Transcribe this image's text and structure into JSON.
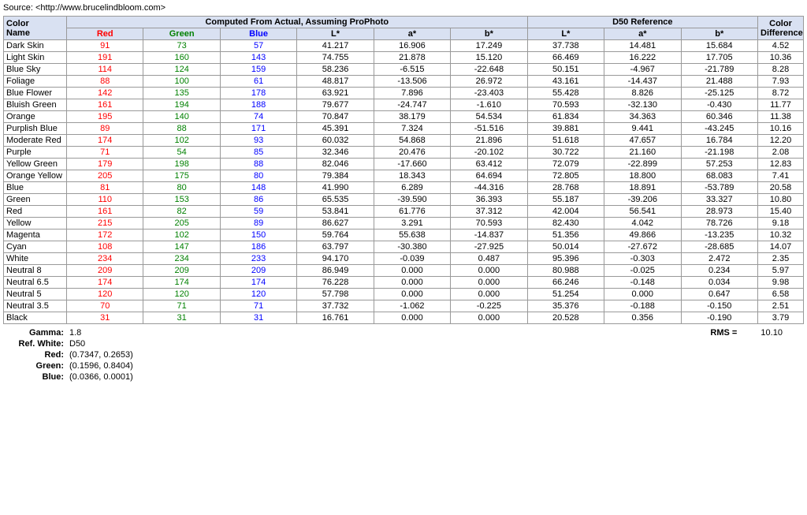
{
  "source": "Source: <http://www.brucelindbloom.com>",
  "headers": {
    "color_name": "Color\nName",
    "computed_group": "Computed From Actual, Assuming ProPhoto",
    "d50_group": "D50 Reference",
    "color_diff": "Color\nDifference",
    "sub_headers": [
      "Red",
      "Green",
      "Blue",
      "L*",
      "a*",
      "b*",
      "L*",
      "a*",
      "b*"
    ]
  },
  "rows": [
    {
      "name": "Dark Skin",
      "r": 91,
      "g": 73,
      "b": 57,
      "L1": 41.217,
      "a1": 16.906,
      "b1": 17.249,
      "L2": 37.738,
      "a2": 14.481,
      "b2": 15.684,
      "diff": 4.52
    },
    {
      "name": "Light Skin",
      "r": 191,
      "g": 160,
      "b": 143,
      "L1": 74.755,
      "a1": 21.878,
      "b1": 15.12,
      "L2": 66.469,
      "a2": 16.222,
      "b2": 17.705,
      "diff": 10.36
    },
    {
      "name": "Blue Sky",
      "r": 114,
      "g": 124,
      "b": 159,
      "L1": 58.236,
      "a1": -6.515,
      "b1": -22.648,
      "L2": 50.151,
      "a2": -4.967,
      "b2": -21.789,
      "diff": 8.28
    },
    {
      "name": "Foliage",
      "r": 88,
      "g": 100,
      "b": 61,
      "L1": 48.817,
      "a1": -13.506,
      "b1": 26.972,
      "L2": 43.161,
      "a2": -14.437,
      "b2": 21.488,
      "diff": 7.93
    },
    {
      "name": "Blue Flower",
      "r": 142,
      "g": 135,
      "b": 178,
      "L1": 63.921,
      "a1": 7.896,
      "b1": -23.403,
      "L2": 55.428,
      "a2": 8.826,
      "b2": -25.125,
      "diff": 8.72
    },
    {
      "name": "Bluish Green",
      "r": 161,
      "g": 194,
      "b": 188,
      "L1": 79.677,
      "a1": -24.747,
      "b1": -1.61,
      "L2": 70.593,
      "a2": -32.13,
      "b2": -0.43,
      "diff": 11.77
    },
    {
      "name": "Orange",
      "r": 195,
      "g": 140,
      "b": 74,
      "L1": 70.847,
      "a1": 38.179,
      "b1": 54.534,
      "L2": 61.834,
      "a2": 34.363,
      "b2": 60.346,
      "diff": 11.38
    },
    {
      "name": "Purplish Blue",
      "r": 89,
      "g": 88,
      "b": 171,
      "L1": 45.391,
      "a1": 7.324,
      "b1": -51.516,
      "L2": 39.881,
      "a2": 9.441,
      "b2": -43.245,
      "diff": 10.16
    },
    {
      "name": "Moderate Red",
      "r": 174,
      "g": 102,
      "b": 93,
      "L1": 60.032,
      "a1": 54.868,
      "b1": 21.896,
      "L2": 51.618,
      "a2": 47.657,
      "b2": 16.784,
      "diff": 12.2
    },
    {
      "name": "Purple",
      "r": 71,
      "g": 54,
      "b": 85,
      "L1": 32.346,
      "a1": 20.476,
      "b1": -20.102,
      "L2": 30.722,
      "a2": 21.16,
      "b2": -21.198,
      "diff": 2.08
    },
    {
      "name": "Yellow Green",
      "r": 179,
      "g": 198,
      "b": 88,
      "L1": 82.046,
      "a1": -17.66,
      "b1": 63.412,
      "L2": 72.079,
      "a2": -22.899,
      "b2": 57.253,
      "diff": 12.83
    },
    {
      "name": "Orange Yellow",
      "r": 205,
      "g": 175,
      "b": 80,
      "L1": 79.384,
      "a1": 18.343,
      "b1": 64.694,
      "L2": 72.805,
      "a2": 18.8,
      "b2": 68.083,
      "diff": 7.41
    },
    {
      "name": "Blue",
      "r": 81,
      "g": 80,
      "b": 148,
      "L1": 41.99,
      "a1": 6.289,
      "b1": -44.316,
      "L2": 28.768,
      "a2": 18.891,
      "b2": -53.789,
      "diff": 20.58
    },
    {
      "name": "Green",
      "r": 110,
      "g": 153,
      "b": 86,
      "L1": 65.535,
      "a1": -39.59,
      "b1": 36.393,
      "L2": 55.187,
      "a2": -39.206,
      "b2": 33.327,
      "diff": 10.8
    },
    {
      "name": "Red",
      "r": 161,
      "g": 82,
      "b": 59,
      "L1": 53.841,
      "a1": 61.776,
      "b1": 37.312,
      "L2": 42.004,
      "a2": 56.541,
      "b2": 28.973,
      "diff": 15.4
    },
    {
      "name": "Yellow",
      "r": 215,
      "g": 205,
      "b": 89,
      "L1": 86.627,
      "a1": 3.291,
      "b1": 70.593,
      "L2": 82.43,
      "a2": 4.042,
      "b2": 78.726,
      "diff": 9.18
    },
    {
      "name": "Magenta",
      "r": 172,
      "g": 102,
      "b": 150,
      "L1": 59.764,
      "a1": 55.638,
      "b1": -14.837,
      "L2": 51.356,
      "a2": 49.866,
      "b2": -13.235,
      "diff": 10.32
    },
    {
      "name": "Cyan",
      "r": 108,
      "g": 147,
      "b": 186,
      "L1": 63.797,
      "a1": -30.38,
      "b1": -27.925,
      "L2": 50.014,
      "a2": -27.672,
      "b2": -28.685,
      "diff": 14.07
    },
    {
      "name": "White",
      "r": 234,
      "g": 234,
      "b": 233,
      "L1": 94.17,
      "a1": -0.039,
      "b1": 0.487,
      "L2": 95.396,
      "a2": -0.303,
      "b2": 2.472,
      "diff": 2.35
    },
    {
      "name": "Neutral 8",
      "r": 209,
      "g": 209,
      "b": 209,
      "L1": 86.949,
      "a1": 0.0,
      "b1": 0.0,
      "L2": 80.988,
      "a2": -0.025,
      "b2": 0.234,
      "diff": 5.97
    },
    {
      "name": "Neutral 6.5",
      "r": 174,
      "g": 174,
      "b": 174,
      "L1": 76.228,
      "a1": 0.0,
      "b1": 0.0,
      "L2": 66.246,
      "a2": -0.148,
      "b2": 0.034,
      "diff": 9.98
    },
    {
      "name": "Neutral 5",
      "r": 120,
      "g": 120,
      "b": 120,
      "L1": 57.798,
      "a1": 0.0,
      "b1": 0.0,
      "L2": 51.254,
      "a2": 0.0,
      "b2": 0.647,
      "diff": 6.58
    },
    {
      "name": "Neutral 3.5",
      "r": 70,
      "g": 71,
      "b": 71,
      "L1": 37.732,
      "a1": -1.062,
      "b1": -0.225,
      "L2": 35.376,
      "a2": -0.188,
      "b2": -0.15,
      "diff": 2.51
    },
    {
      "name": "Black",
      "r": 31,
      "g": 31,
      "b": 31,
      "L1": 16.761,
      "a1": 0.0,
      "b1": 0.0,
      "L2": 20.528,
      "a2": 0.356,
      "b2": -0.19,
      "diff": 3.79
    }
  ],
  "footer": {
    "gamma_label": "Gamma:",
    "gamma_value": "1.8",
    "ref_white_label": "Ref. White:",
    "ref_white_value": "D50",
    "red_label": "Red:",
    "red_value": "(0.7347, 0.2653)",
    "green_label": "Green:",
    "green_value": "(0.1596, 0.8404)",
    "blue_label": "Blue:",
    "blue_value": "(0.0366, 0.0001)",
    "rms_label": "RMS =",
    "rms_value": "10.10"
  }
}
